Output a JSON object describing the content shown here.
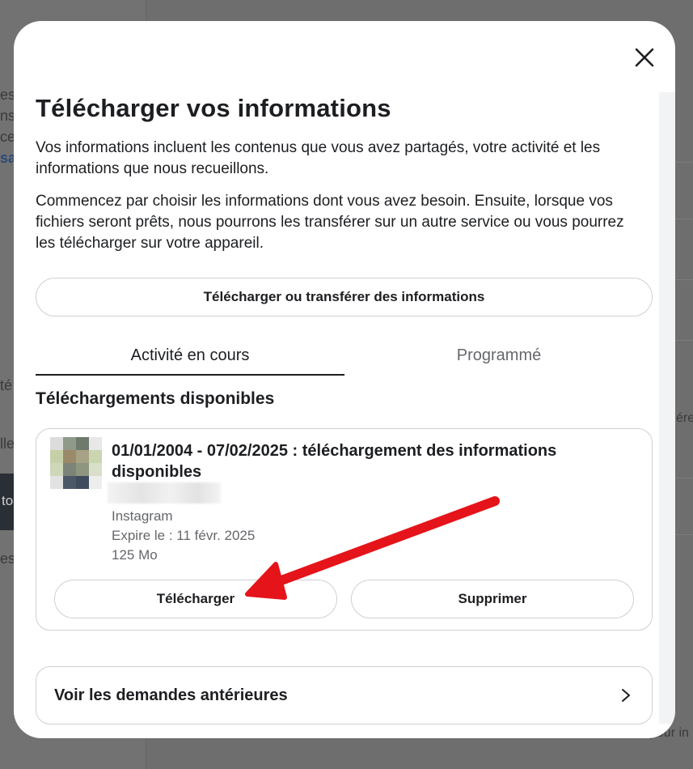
{
  "background": {
    "fragments_left": [
      "es",
      "ns",
      "ce",
      "sa",
      "té",
      "lle",
      "es"
    ],
    "fragment_dark": "to",
    "fragments_right": [
      "ére",
      "pour in"
    ]
  },
  "modal": {
    "close_icon": "close-icon",
    "title": "Télécharger vos informations",
    "paragraph1": "Vos informations incluent les contenus que vous avez partagés, votre activité et les informations que nous recueillons.",
    "paragraph2": "Commencez par choisir les informations dont vous avez besoin. Ensuite, lorsque vos fichiers seront prêts, nous pourrons les transférer sur un autre service ou vous pourrez les télécharger sur votre appareil.",
    "main_button": "Télécharger ou transférer des informations",
    "tabs": [
      {
        "label": "Activité en cours",
        "active": true
      },
      {
        "label": "Programmé",
        "active": false
      }
    ],
    "section_title": "Téléchargements disponibles",
    "download_card": {
      "title": "01/01/2004 - 07/02/2025 : téléchargement des informations disponibles",
      "platform": "Instagram",
      "expires": "Expire le : 11 févr. 2025",
      "size": "125 Mo",
      "download_button": "Télécharger",
      "delete_button": "Supprimer"
    },
    "history_link": "Voir les demandes antérieures",
    "chevron_icon": "chevron-right-icon"
  },
  "annotation": {
    "arrow_color": "#e5141a"
  },
  "colors": {
    "text_primary": "#1c1e21",
    "text_secondary": "#65676b",
    "border": "#ced0d4"
  }
}
